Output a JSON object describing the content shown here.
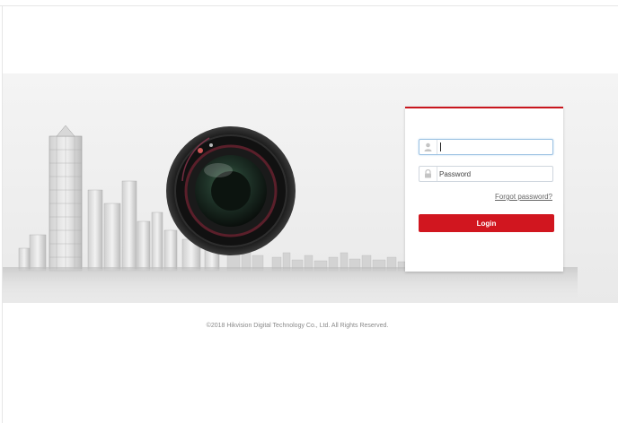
{
  "login": {
    "username_value": "",
    "username_placeholder": "",
    "password_placeholder": "Password",
    "forgot_label": "Forgot password?",
    "login_label": "Login"
  },
  "footer": {
    "copyright": "©2018 Hikvision Digital Technology Co., Ltd. All Rights Reserved."
  },
  "colors": {
    "accent": "#d1161f",
    "panel_border": "#c8161d",
    "field_focus": "#9ec3e3"
  },
  "icons": {
    "username": "user-icon",
    "password": "lock-icon"
  }
}
